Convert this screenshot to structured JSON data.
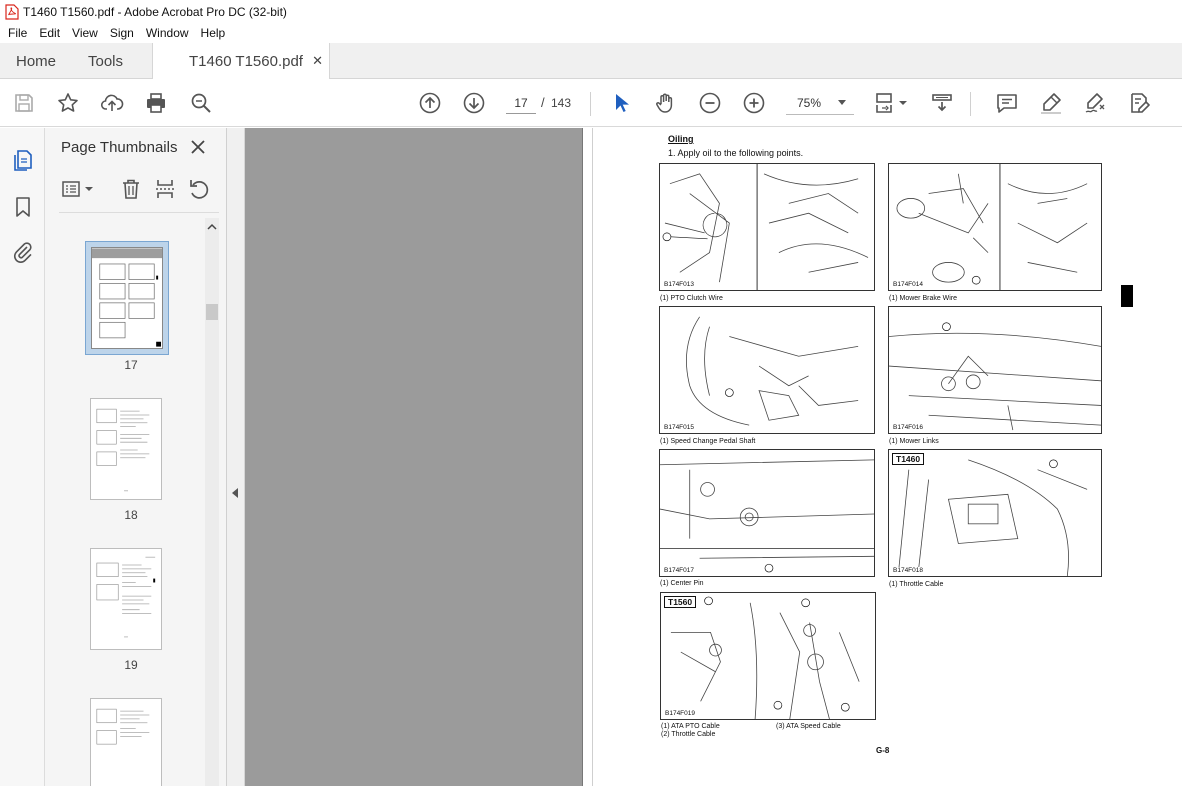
{
  "window": {
    "title": "T1460 T1560.pdf - Adobe Acrobat Pro DC (32-bit)"
  },
  "menu": [
    "File",
    "Edit",
    "View",
    "Sign",
    "Window",
    "Help"
  ],
  "tabs": {
    "home": "Home",
    "tools": "Tools",
    "document": "T1460 T1560.pdf",
    "close_glyph": "✕"
  },
  "toolbar": {
    "current_page": "17",
    "page_separator": "/",
    "total_pages": "143",
    "zoom": "75%",
    "icons": [
      "save-icon",
      "star-icon",
      "upload-icon",
      "print-icon",
      "zoom-search-icon",
      "page-up-icon",
      "page-down-icon",
      "select-arrow-icon",
      "hand-icon",
      "zoom-out-icon",
      "zoom-in-icon",
      "page-layout-icon",
      "scroll-mode-icon",
      "comment-icon",
      "highlight-icon",
      "sign-icon",
      "edit-pdf-icon"
    ]
  },
  "thumbnails": {
    "panel_title": "Page Thumbnails",
    "close_glyph": "✕",
    "pages": [
      {
        "label": "17",
        "active": true
      },
      {
        "label": "18",
        "active": false
      },
      {
        "label": "19",
        "active": false
      },
      {
        "label": "",
        "active": false
      }
    ]
  },
  "document_page": {
    "section_title": "Oiling",
    "instruction": "1. Apply oil to the following points.",
    "figures": [
      {
        "code": "B174F013",
        "model": "",
        "captions": [
          "(1)   PTO Clutch Wire"
        ]
      },
      {
        "code": "B174F014",
        "model": "",
        "captions": [
          "(1)   Mower Brake Wire"
        ]
      },
      {
        "code": "B174F015",
        "model": "",
        "captions": [
          "(1)   Speed Change Pedal Shaft"
        ]
      },
      {
        "code": "B174F016",
        "model": "",
        "captions": [
          "(1)   Mower Links"
        ]
      },
      {
        "code": "B174F017",
        "model": "",
        "captions": [
          "(1)   Center Pin"
        ]
      },
      {
        "code": "B174F018",
        "model": "T1460",
        "captions": [
          "(1)   Throttle Cable"
        ]
      },
      {
        "code": "B174F019",
        "model": "T1560",
        "captions": [
          "(1)   ATA PTO Cable",
          "(2)   Throttle Cable",
          "(3)   ATA Speed Cable"
        ]
      }
    ],
    "page_number": "G-8"
  },
  "colors": {
    "doc_background": "#9b9b9b",
    "thumb_highlight": "#bdd4ea",
    "pdf_icon_red": "#d9261c"
  }
}
